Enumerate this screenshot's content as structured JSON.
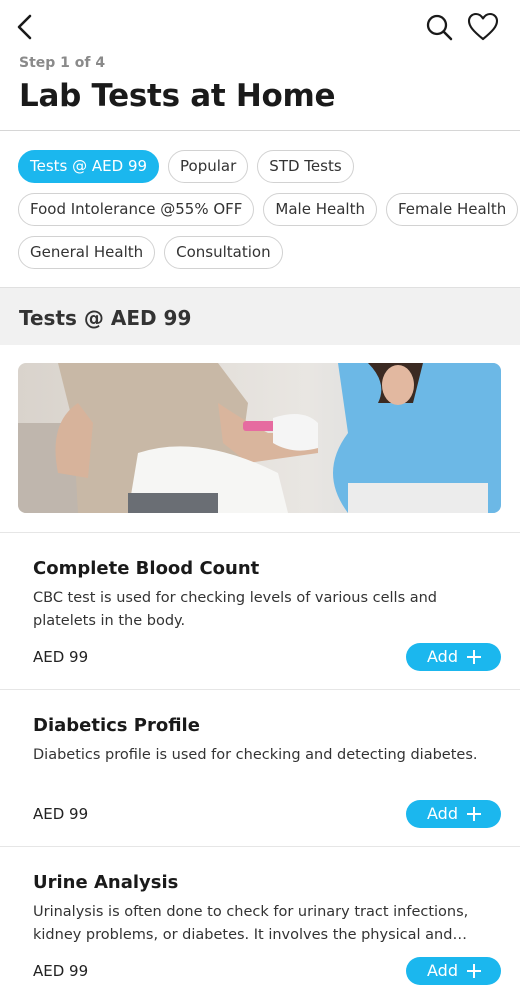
{
  "header": {
    "step": "Step 1 of 4",
    "title": "Lab Tests at Home"
  },
  "filters": [
    {
      "label": "Tests @ AED 99",
      "active": true
    },
    {
      "label": "Popular",
      "active": false
    },
    {
      "label": "STD Tests",
      "active": false
    },
    {
      "label": "Food Intolerance @55% OFF",
      "active": false
    },
    {
      "label": "Male Health",
      "active": false
    },
    {
      "label": "Female Health",
      "active": false
    },
    {
      "label": "General Health",
      "active": false
    },
    {
      "label": "Consultation",
      "active": false
    }
  ],
  "section": {
    "title": "Tests @ AED 99"
  },
  "tests": [
    {
      "name": "Complete Blood Count",
      "description": "CBC test is used for checking levels of various cells and platelets in the body.",
      "price": "AED 99",
      "add_label": "Add"
    },
    {
      "name": "Diabetics Profile",
      "description": "Diabetics profile is used for checking and detecting diabetes.",
      "price": "AED 99",
      "add_label": "Add"
    },
    {
      "name": "Urine Analysis",
      "description": "Urinalysis is often done to check for urinary tract infections, kidney problems, or diabetes. It involves the physical and chemical examination of urine.",
      "price": "AED 99",
      "add_label": "Add"
    }
  ],
  "icons": {
    "back": "chevron-left-icon",
    "search": "search-icon",
    "favorite": "heart-icon",
    "add": "plus-icon"
  },
  "colors": {
    "accent": "#1bb7ee",
    "section_bg": "#f1f1f1"
  }
}
